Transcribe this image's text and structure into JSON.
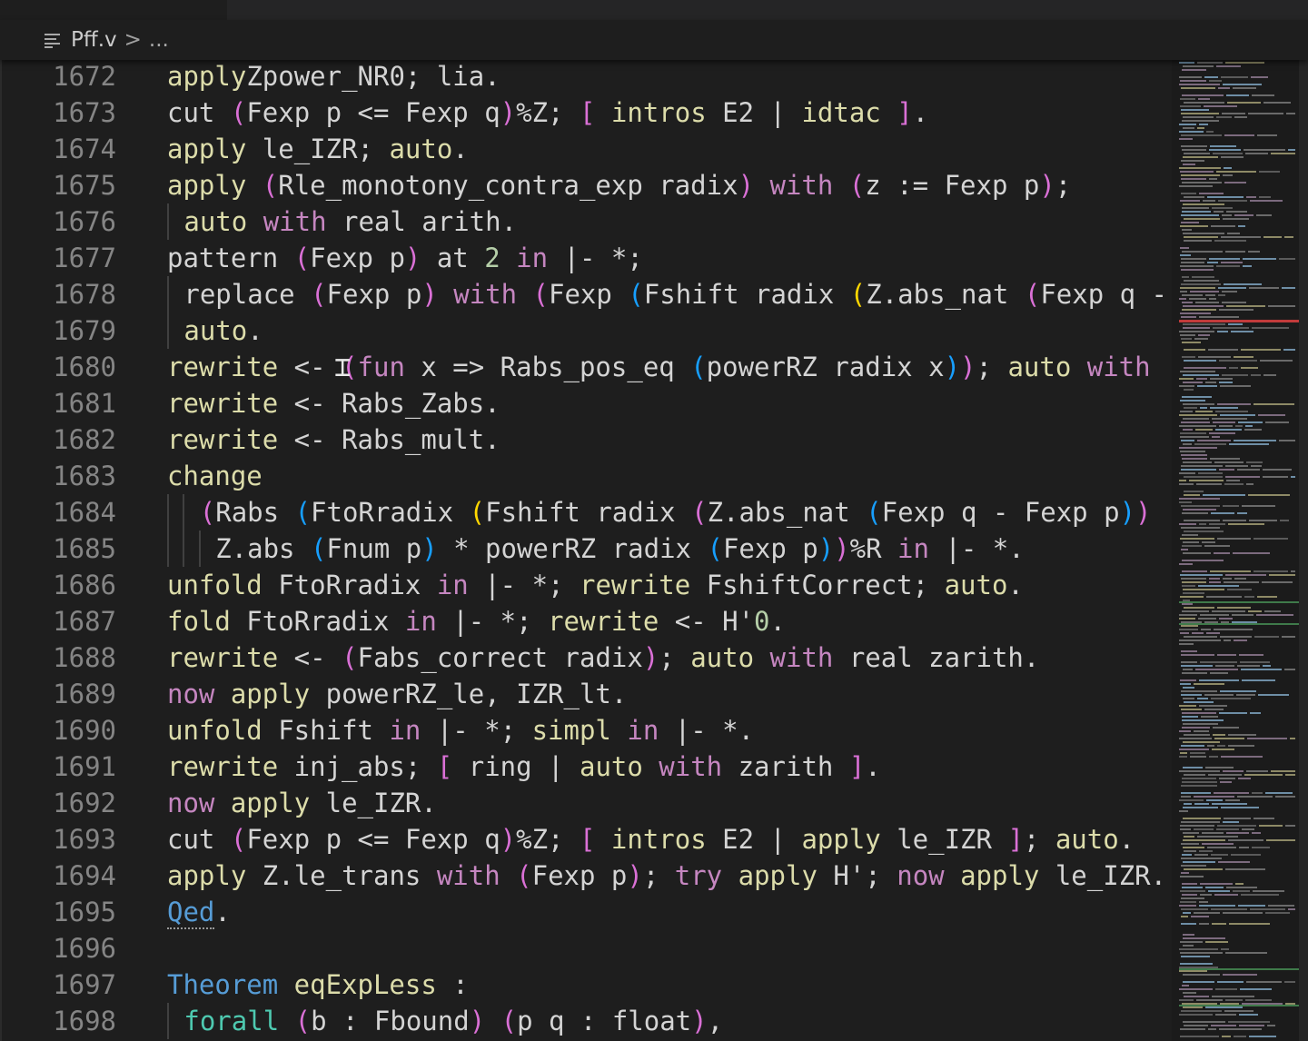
{
  "breadcrumb": {
    "icon": "list-lines-icon",
    "file": "Pff.v",
    "separator": ">",
    "symbol": "..."
  },
  "editor": {
    "lines": [
      {
        "num": "1672",
        "segs": [
          [
            "tac",
            "apply"
          ],
          [
            "",
            "Zpower_NR0; lia."
          ]
        ]
      },
      {
        "num": "1673",
        "segs": [
          [
            "",
            "cut "
          ],
          [
            "b1",
            "("
          ],
          [
            "",
            "Fexp p <= Fexp q"
          ],
          [
            "b1",
            ")"
          ],
          [
            "",
            "%Z; "
          ],
          [
            "b1",
            "["
          ],
          [
            "tac",
            " intros"
          ],
          [
            "",
            " E2 | "
          ],
          [
            "tac",
            "idtac"
          ],
          [
            "b1",
            " ]"
          ],
          [
            "",
            "."
          ]
        ]
      },
      {
        "num": "1674",
        "segs": [
          [
            "tac",
            "apply"
          ],
          [
            "",
            " le_IZR; "
          ],
          [
            "tac",
            "auto"
          ],
          [
            "",
            "."
          ]
        ]
      },
      {
        "num": "1675",
        "segs": [
          [
            "tac",
            "apply"
          ],
          [
            "b1",
            " ("
          ],
          [
            "",
            "Rle_monotony_contra_exp radix"
          ],
          [
            "b1",
            ")"
          ],
          [
            "kw",
            " with"
          ],
          [
            "b1",
            " ("
          ],
          [
            "",
            "z := Fexp p"
          ],
          [
            "b1",
            ")"
          ],
          [
            "",
            ";"
          ]
        ]
      },
      {
        "num": "1676",
        "indent": 1,
        "segs": [
          [
            "tac",
            "auto"
          ],
          [
            "kw",
            " with"
          ],
          [
            "",
            " real arith."
          ]
        ]
      },
      {
        "num": "1677",
        "segs": [
          [
            "",
            "pattern "
          ],
          [
            "b1",
            "("
          ],
          [
            "",
            "Fexp p"
          ],
          [
            "b1",
            ")"
          ],
          [
            "",
            " at "
          ],
          [
            "num",
            "2"
          ],
          [
            "kw",
            " in"
          ],
          [
            "",
            " |- *;"
          ]
        ]
      },
      {
        "num": "1678",
        "indent": 1,
        "segs": [
          [
            "",
            "replace "
          ],
          [
            "b1",
            "("
          ],
          [
            "",
            "Fexp p"
          ],
          [
            "b1",
            ")"
          ],
          [
            "kw",
            " with"
          ],
          [
            "b1",
            " ("
          ],
          [
            "",
            "Fexp "
          ],
          [
            "b2",
            "("
          ],
          [
            "",
            "Fshift radix "
          ],
          [
            "b3",
            "("
          ],
          [
            "",
            "Z.abs_nat "
          ],
          [
            "b1",
            "("
          ],
          [
            "",
            "Fexp q -"
          ]
        ]
      },
      {
        "num": "1679",
        "indent": 1,
        "segs": [
          [
            "tac",
            "auto"
          ],
          [
            "",
            "."
          ]
        ]
      },
      {
        "num": "1680",
        "cursor": true,
        "segs": [
          [
            "tac",
            "rewrite"
          ],
          [
            "",
            " <- "
          ],
          [
            "b1",
            "("
          ],
          [
            "kw",
            "fun"
          ],
          [
            "",
            " x => Rabs_pos_eq "
          ],
          [
            "b2",
            "("
          ],
          [
            "",
            "powerRZ radix x"
          ],
          [
            "b2",
            ")"
          ],
          [
            "b1",
            ")"
          ],
          [
            "",
            "; "
          ],
          [
            "tac",
            "auto"
          ],
          [
            "kw",
            " with"
          ]
        ]
      },
      {
        "num": "1681",
        "segs": [
          [
            "tac",
            "rewrite"
          ],
          [
            "",
            " <- Rabs_Zabs."
          ]
        ]
      },
      {
        "num": "1682",
        "segs": [
          [
            "tac",
            "rewrite"
          ],
          [
            "",
            " <- Rabs_mult."
          ]
        ]
      },
      {
        "num": "1683",
        "segs": [
          [
            "tac",
            "change"
          ]
        ]
      },
      {
        "num": "1684",
        "indent": 2,
        "segs": [
          [
            "b1",
            "("
          ],
          [
            "",
            "Rabs "
          ],
          [
            "b2",
            "("
          ],
          [
            "",
            "FtoRradix "
          ],
          [
            "b3",
            "("
          ],
          [
            "",
            "Fshift radix "
          ],
          [
            "b1",
            "("
          ],
          [
            "",
            "Z.abs_nat "
          ],
          [
            "b2",
            "("
          ],
          [
            "",
            "Fexp q - Fexp p"
          ],
          [
            "b2",
            ")"
          ],
          [
            "b1",
            ")"
          ]
        ]
      },
      {
        "num": "1685",
        "indent": 3,
        "segs": [
          [
            "",
            "Z.abs "
          ],
          [
            "b2",
            "("
          ],
          [
            "",
            "Fnum p"
          ],
          [
            "b2",
            ")"
          ],
          [
            "",
            " * powerRZ radix "
          ],
          [
            "b2",
            "("
          ],
          [
            "",
            "Fexp p"
          ],
          [
            "b2",
            ")"
          ],
          [
            "b1",
            ")"
          ],
          [
            "",
            "%R"
          ],
          [
            "kw",
            " in"
          ],
          [
            "",
            " |- *."
          ]
        ]
      },
      {
        "num": "1686",
        "segs": [
          [
            "tac",
            "unfold"
          ],
          [
            "",
            " FtoRradix"
          ],
          [
            "kw",
            " in"
          ],
          [
            "",
            " |- *; "
          ],
          [
            "tac",
            "rewrite"
          ],
          [
            "",
            " FshiftCorrect; "
          ],
          [
            "tac",
            "auto"
          ],
          [
            "",
            "."
          ]
        ]
      },
      {
        "num": "1687",
        "segs": [
          [
            "tac",
            "fold"
          ],
          [
            "",
            " FtoRradix"
          ],
          [
            "kw",
            " in"
          ],
          [
            "",
            " |- *; "
          ],
          [
            "tac",
            "rewrite"
          ],
          [
            "",
            " <- H'"
          ],
          [
            "num",
            "0"
          ],
          [
            "",
            "."
          ]
        ]
      },
      {
        "num": "1688",
        "segs": [
          [
            "tac",
            "rewrite"
          ],
          [
            "",
            " <- "
          ],
          [
            "b1",
            "("
          ],
          [
            "",
            "Fabs_correct radix"
          ],
          [
            "b1",
            ")"
          ],
          [
            "",
            "; "
          ],
          [
            "tac",
            "auto"
          ],
          [
            "kw",
            " with"
          ],
          [
            "",
            " real zarith."
          ]
        ]
      },
      {
        "num": "1689",
        "segs": [
          [
            "kw",
            "now"
          ],
          [
            "tac",
            " apply"
          ],
          [
            "",
            " powerRZ_le, IZR_lt."
          ]
        ]
      },
      {
        "num": "1690",
        "segs": [
          [
            "tac",
            "unfold"
          ],
          [
            "",
            " Fshift"
          ],
          [
            "kw",
            " in"
          ],
          [
            "",
            " |- *; "
          ],
          [
            "tac",
            "simpl"
          ],
          [
            "kw",
            " in"
          ],
          [
            "",
            " |- *."
          ]
        ]
      },
      {
        "num": "1691",
        "segs": [
          [
            "tac",
            "rewrite"
          ],
          [
            "",
            " inj_abs; "
          ],
          [
            "b1",
            "["
          ],
          [
            "",
            " ring | "
          ],
          [
            "tac",
            "auto"
          ],
          [
            "kw",
            " with"
          ],
          [
            "",
            " zarith "
          ],
          [
            "b1",
            "]"
          ],
          [
            "",
            "."
          ]
        ]
      },
      {
        "num": "1692",
        "segs": [
          [
            "kw",
            "now"
          ],
          [
            "tac",
            " apply"
          ],
          [
            "",
            " le_IZR."
          ]
        ]
      },
      {
        "num": "1693",
        "segs": [
          [
            "",
            "cut "
          ],
          [
            "b1",
            "("
          ],
          [
            "",
            "Fexp p <= Fexp q"
          ],
          [
            "b1",
            ")"
          ],
          [
            "",
            "%Z; "
          ],
          [
            "b1",
            "["
          ],
          [
            "tac",
            " intros"
          ],
          [
            "",
            " E2 | "
          ],
          [
            "tac",
            "apply"
          ],
          [
            "",
            " le_IZR "
          ],
          [
            "b1",
            "]"
          ],
          [
            "",
            "; "
          ],
          [
            "tac",
            "auto"
          ],
          [
            "",
            "."
          ]
        ]
      },
      {
        "num": "1694",
        "segs": [
          [
            "tac",
            "apply"
          ],
          [
            "",
            " Z.le_trans"
          ],
          [
            "kw",
            " with"
          ],
          [
            "b1",
            " ("
          ],
          [
            "",
            "Fexp p"
          ],
          [
            "b1",
            ")"
          ],
          [
            "",
            "; "
          ],
          [
            "kw",
            "try"
          ],
          [
            "tac",
            " apply"
          ],
          [
            "",
            " H'; "
          ],
          [
            "kw",
            "now"
          ],
          [
            "tac",
            " apply"
          ],
          [
            "",
            " le_IZR."
          ]
        ]
      },
      {
        "num": "1695",
        "segs": [
          [
            "blue squig",
            "Qed"
          ],
          [
            "",
            "."
          ]
        ]
      },
      {
        "num": "1696",
        "segs": []
      },
      {
        "num": "1697",
        "segs": [
          [
            "blue",
            "Theorem"
          ],
          [
            "tac",
            " eqExpLess"
          ],
          [
            "",
            " :"
          ]
        ]
      },
      {
        "num": "1698",
        "indent": 1,
        "segs": [
          [
            "typ",
            "forall"
          ],
          [
            "b1",
            " ("
          ],
          [
            "",
            "b : Fbound"
          ],
          [
            "b1",
            ")"
          ],
          [
            "b1",
            " ("
          ],
          [
            "",
            "p q : float"
          ],
          [
            "b1",
            ")"
          ],
          [
            "",
            ","
          ]
        ]
      }
    ]
  },
  "colors": {
    "background": "#1e1e1e",
    "keyword": "#c586c0",
    "tactic": "#dcdcaa",
    "vernacular": "#569cd6",
    "bracket_1": "#da70d6",
    "bracket_2": "#179fff",
    "bracket_3": "#ffd700"
  }
}
